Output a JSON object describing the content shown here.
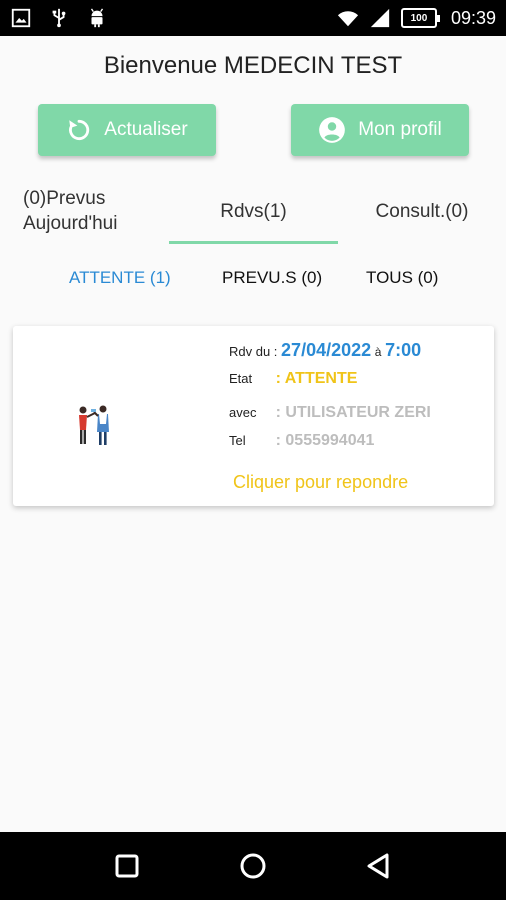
{
  "status_bar": {
    "time": "09:39",
    "battery": "100",
    "left_icons": [
      "image-icon",
      "usb-icon",
      "android-icon"
    ],
    "right_icons": [
      "wifi-icon",
      "signal-icon",
      "battery-icon"
    ]
  },
  "header": {
    "welcome": "Bienvenue MEDECIN TEST"
  },
  "buttons": {
    "refresh": {
      "label": "Actualiser",
      "icon": "refresh-icon"
    },
    "profile": {
      "label": "Mon profil",
      "icon": "account-circle-icon"
    }
  },
  "tabs": {
    "prevus_count": "(0)Prevus",
    "prevus_today": "Aujourd'hui",
    "rdvs": "Rdvs(1)",
    "consult": "Consult.(0)"
  },
  "subtabs": {
    "attente": "ATTENTE (1)",
    "prevus": "PREVU.S (0)",
    "tous": "TOUS (0)"
  },
  "appointment": {
    "rdv_label": "Rdv du :",
    "date": "27/04/2022",
    "a_sep": "à",
    "time": "7:00",
    "etat_label": "Etat",
    "etat_value": ": ATTENTE",
    "avec_label": "avec",
    "avec_value": ": UTILISATEUR ZERI",
    "tel_label": "Tel",
    "tel_value": ": 0555994041",
    "reply": "Cliquer pour repondre"
  },
  "colors": {
    "accent_green": "#80d8a8",
    "accent_blue": "#2a8ad4",
    "status_yellow": "#f0c419",
    "muted_grey": "#bdbdbd"
  },
  "nav": {
    "icons": [
      "recents-square-icon",
      "home-circle-icon",
      "back-triangle-icon"
    ]
  }
}
